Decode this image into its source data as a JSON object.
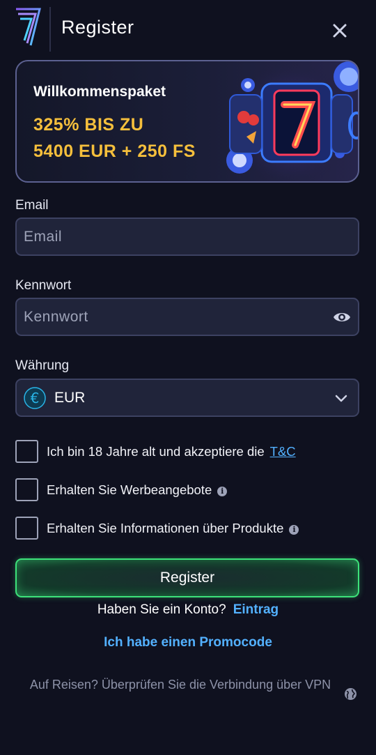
{
  "header": {
    "title": "Register",
    "logo_icon": "brand-7-logo-icon",
    "close_icon": "close-icon"
  },
  "banner": {
    "title": "Willkommenspaket",
    "offer_line1": "325% BIS ZU",
    "offer_line2": "5400 EUR + 250 FS",
    "art_icon": "slot-machine-seven-illustration"
  },
  "form": {
    "email": {
      "label": "Email",
      "placeholder": "Email",
      "value": ""
    },
    "password": {
      "label": "Kennwort",
      "placeholder": "Kennwort",
      "value": "",
      "toggle_icon": "eye-icon"
    },
    "currency": {
      "label": "Währung",
      "value": "EUR",
      "icon": "euro-icon",
      "dropdown_icon": "chevron-down-icon"
    }
  },
  "checkboxes": [
    {
      "label": "Ich bin 18 Jahre alt und akzeptiere die",
      "link": "T&C",
      "checked": false
    },
    {
      "label": "Erhalten Sie Werbeangebote",
      "info_icon": "info-icon",
      "checked": false
    },
    {
      "label": "Erhalten Sie Informationen über Produkte",
      "info_icon": "info-icon",
      "checked": false
    }
  ],
  "actions": {
    "register_label": "Register",
    "have_account": "Haben Sie ein Konto?",
    "login_link": "Eintrag",
    "promo_link": "Ich habe einen Promocode"
  },
  "vpn": {
    "text": "Auf Reisen? Überprüfen Sie die Verbindung über VPN",
    "icon": "globe-icon"
  },
  "colors": {
    "background": "#0f111f",
    "field_bg": "#20243a",
    "accent_gold": "#f5bf3c",
    "link_blue": "#53b1ff",
    "register_green": "#3de27a"
  }
}
